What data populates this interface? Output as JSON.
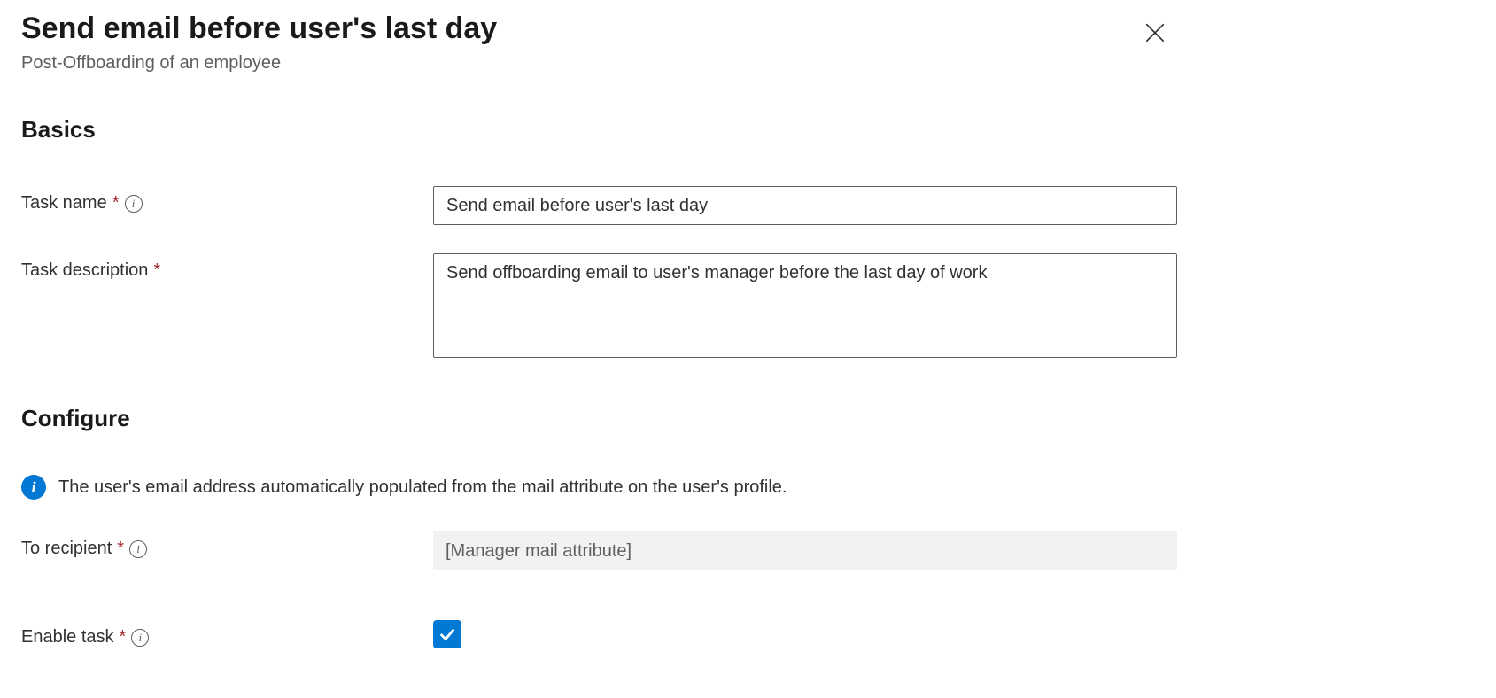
{
  "header": {
    "title": "Send email before user's last day",
    "subtitle": "Post-Offboarding of an employee"
  },
  "sections": {
    "basics": {
      "heading": "Basics",
      "task_name_label": "Task name",
      "task_name_value": "Send email before user's last day",
      "task_description_label": "Task description",
      "task_description_value": "Send offboarding email to user's manager before the last day of work"
    },
    "configure": {
      "heading": "Configure",
      "info_text": "The user's email address automatically populated from the mail attribute on the user's profile.",
      "to_recipient_label": "To recipient",
      "to_recipient_value": "[Manager mail attribute]",
      "enable_task_label": "Enable task",
      "enable_task_checked": true
    }
  }
}
